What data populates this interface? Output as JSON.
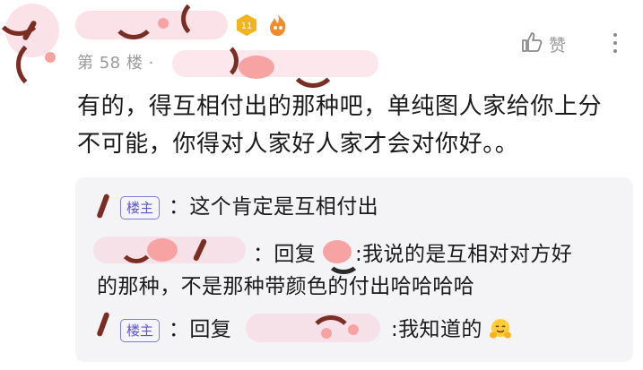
{
  "post": {
    "floor_label": "第 58 楼 ·",
    "like_label": "赞",
    "level_badge": "11",
    "content": "有的，得互相付出的那种吧，单纯图人家给你上分不可能，你得对人家好人家才会对你好。。"
  },
  "replies": [
    {
      "tag": "楼主",
      "text": "：这个肯定是互相付出"
    },
    {
      "reply_prefix": "：回复",
      "text_line1": ":我说的是互相对对方好",
      "text_line2": "的那种，不是那种带颜色的付出哈哈哈哈"
    },
    {
      "tag": "楼主",
      "reply_prefix": "：回复",
      "text": ":我知道的"
    }
  ],
  "icons": {
    "like": "thumbs-up-icon",
    "more": "more-vertical-icon",
    "level": "level-badge-icon",
    "flame": "flame-badge-icon",
    "emoji": "hugging-face-emoji"
  },
  "colors": {
    "op_tag": "#5a57cc",
    "meta_gray": "#9a9a9a",
    "reply_bg": "#f4f4f6"
  }
}
